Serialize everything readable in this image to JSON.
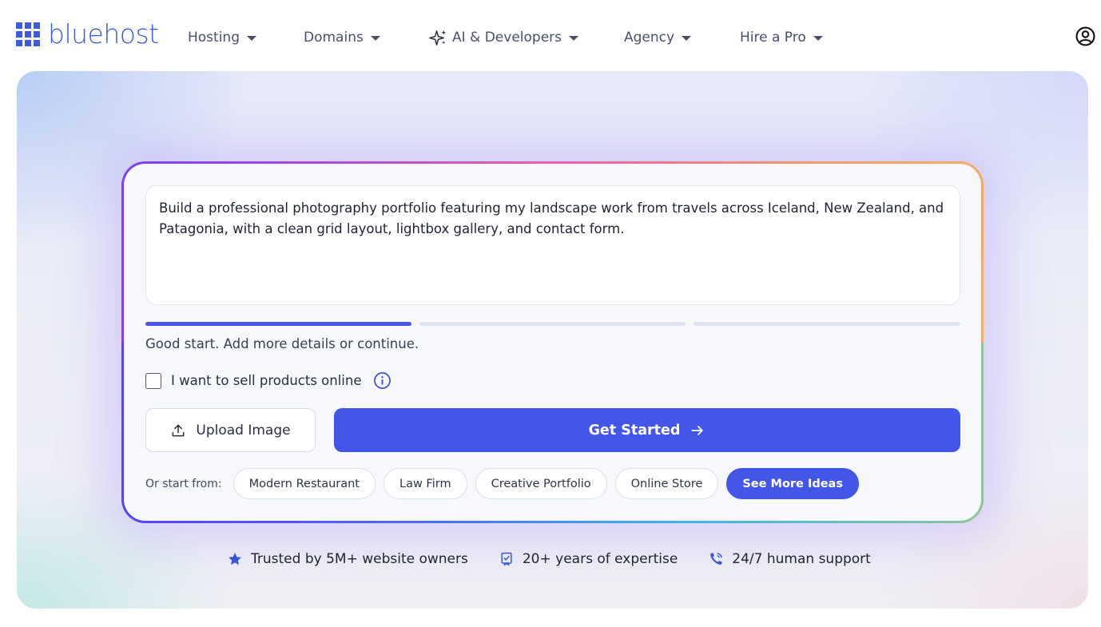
{
  "brand": {
    "name": "bluehost",
    "color": "#3b5bdb"
  },
  "nav": {
    "items": [
      {
        "label": "Hosting"
      },
      {
        "label": "Domains"
      },
      {
        "label": "AI & Developers",
        "icon": "sparkle-icon"
      },
      {
        "label": "Agency"
      },
      {
        "label": "Hire a Pro"
      }
    ],
    "account_icon": "user-circle-icon"
  },
  "builder": {
    "prompt_text": "Build a professional photography portfolio featuring my landscape work from travels across Iceland, New Zealand, and Patagonia, with a clean grid layout, lightbox gallery, and contact form.",
    "progress": {
      "segments": 3,
      "filled": 1
    },
    "hint": "Good start. Add more details or continue.",
    "sell_label": "I want to sell products online",
    "sell_checked": false,
    "upload_label": "Upload Image",
    "start_label": "Get Started",
    "ideas_label": "Or start from:",
    "ideas": [
      "Modern Restaurant",
      "Law Firm",
      "Creative Portfolio",
      "Online Store"
    ],
    "more_ideas_label": "See More Ideas",
    "accent": "#4456e8"
  },
  "trust": [
    {
      "icon": "star-icon",
      "label": "Trusted by 5M+ website owners"
    },
    {
      "icon": "certificate-icon",
      "label": "20+ years of expertise"
    },
    {
      "icon": "phone-icon",
      "label": "24/7 human support"
    }
  ]
}
